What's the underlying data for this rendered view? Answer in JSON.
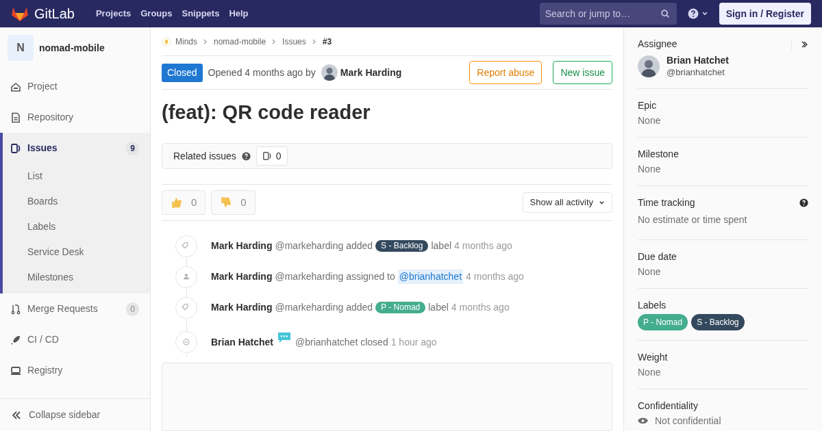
{
  "topbar": {
    "brand": "GitLab",
    "nav": [
      "Projects",
      "Groups",
      "Snippets",
      "Help"
    ],
    "search": {
      "placeholder": "Search or jump to…"
    },
    "sign_in": "Sign in / Register"
  },
  "sidebar": {
    "project_initial": "N",
    "project_name": "nomad-mobile",
    "items": [
      {
        "label": "Project",
        "kind": "home",
        "selected": false
      },
      {
        "label": "Repository",
        "kind": "doc",
        "selected": false
      },
      {
        "label": "Issues",
        "kind": "issues",
        "selected": true,
        "count": "9",
        "children": [
          {
            "label": "List",
            "selected": false
          },
          {
            "label": "Boards",
            "selected": false
          },
          {
            "label": "Labels",
            "selected": false
          },
          {
            "label": "Service Desk",
            "selected": false
          },
          {
            "label": "Milestones",
            "selected": false
          }
        ]
      },
      {
        "label": "Merge Requests",
        "kind": "merge",
        "selected": false,
        "count": "0"
      },
      {
        "label": "CI / CD",
        "kind": "rocket",
        "selected": false
      },
      {
        "label": "Registry",
        "kind": "registry",
        "selected": false
      }
    ],
    "collapse": "Collapse sidebar"
  },
  "breadcrumb": [
    "Minds",
    "nomad-mobile",
    "Issues",
    "#3"
  ],
  "issue": {
    "status": "Closed",
    "opened": "Opened 4 months ago by",
    "author": "Mark Harding",
    "report": "Report abuse",
    "new_issue": "New issue",
    "title": "(feat): QR code reader"
  },
  "related": {
    "label": "Related issues",
    "count": "0"
  },
  "awards": [
    {
      "kind": "thumbsup",
      "count": "0"
    },
    {
      "kind": "thumbsdown",
      "count": "0"
    }
  ],
  "activity_filter": "Show all activity",
  "activity": [
    {
      "kind": "tag",
      "author": "Mark Harding",
      "handle": "@markeharding",
      "action": "added",
      "label": {
        "text": "S - Backlog",
        "color": "#34495e"
      },
      "after": "label",
      "time": "4 months ago"
    },
    {
      "kind": "person",
      "author": "Mark Harding",
      "handle": "@markeharding",
      "action": "assigned to",
      "mention": "@brianhatchet",
      "time": "4 months ago"
    },
    {
      "kind": "tag",
      "author": "Mark Harding",
      "handle": "@markeharding",
      "action": "added",
      "label": {
        "text": "P - Nomad",
        "color": "#44ad8e"
      },
      "after": "label",
      "time": "4 months ago"
    },
    {
      "kind": "closed",
      "author": "Brian Hatchet",
      "chat_badge": true,
      "handle": "@brianhatchet",
      "action": "closed",
      "time": "1 hour ago"
    }
  ],
  "right_sidebar": {
    "assignee": {
      "heading": "Assignee",
      "name": "Brian Hatchet",
      "handle": "@brianhatchet"
    },
    "sections": [
      {
        "heading": "Epic",
        "value": "None"
      },
      {
        "heading": "Milestone",
        "value": "None"
      },
      {
        "heading": "Time tracking",
        "value": "No estimate or time spent",
        "help": true
      },
      {
        "heading": "Due date",
        "value": "None"
      }
    ],
    "labels": {
      "heading": "Labels",
      "items": [
        {
          "text": "P - Nomad",
          "color": "#44ad8e"
        },
        {
          "text": "S - Backlog",
          "color": "#34495e"
        }
      ]
    },
    "weight": {
      "heading": "Weight",
      "value": "None"
    },
    "confidentiality": {
      "heading": "Confidentiality",
      "value": "Not confidential"
    }
  }
}
